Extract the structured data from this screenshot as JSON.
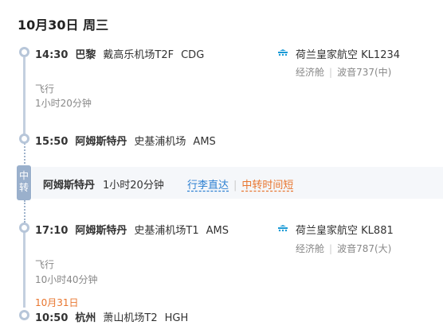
{
  "header": {
    "date": "10月30日 周三"
  },
  "segment1": {
    "departure": {
      "time": "14:30",
      "city": "巴黎",
      "airport": "戴高乐机场T2F",
      "code": "CDG"
    },
    "airline": {
      "name": "荷兰皇家航空",
      "flight": "KL1234",
      "cabin": "经济舱",
      "aircraft": "波音737(中)"
    },
    "fly_label": "飞行",
    "duration": "1小时20分钟",
    "arrival": {
      "time": "15:50",
      "city": "阿姆斯特丹",
      "airport": "史基浦机场",
      "code": "AMS"
    }
  },
  "transfer": {
    "badge": "中转",
    "city": "阿姆斯特丹",
    "duration": "1小时20分钟",
    "link_baggage": "行李直达",
    "link_short": "中转时间短"
  },
  "segment2": {
    "departure": {
      "time": "17:10",
      "city": "阿姆斯特丹",
      "airport": "史基浦机场T1",
      "code": "AMS"
    },
    "airline": {
      "name": "荷兰皇家航空",
      "flight": "KL881",
      "cabin": "经济舱",
      "aircraft": "波音787(大)"
    },
    "fly_label": "飞行",
    "duration": "10小时40分钟",
    "arrival_date": "10月31日",
    "arrival": {
      "time": "10:50",
      "city": "杭州",
      "airport": "萧山机场T2",
      "code": "HGH"
    }
  },
  "colors": {
    "accent_blue": "#2b7fd1",
    "accent_orange": "#e8752e",
    "timeline": "#b7c6d9"
  }
}
